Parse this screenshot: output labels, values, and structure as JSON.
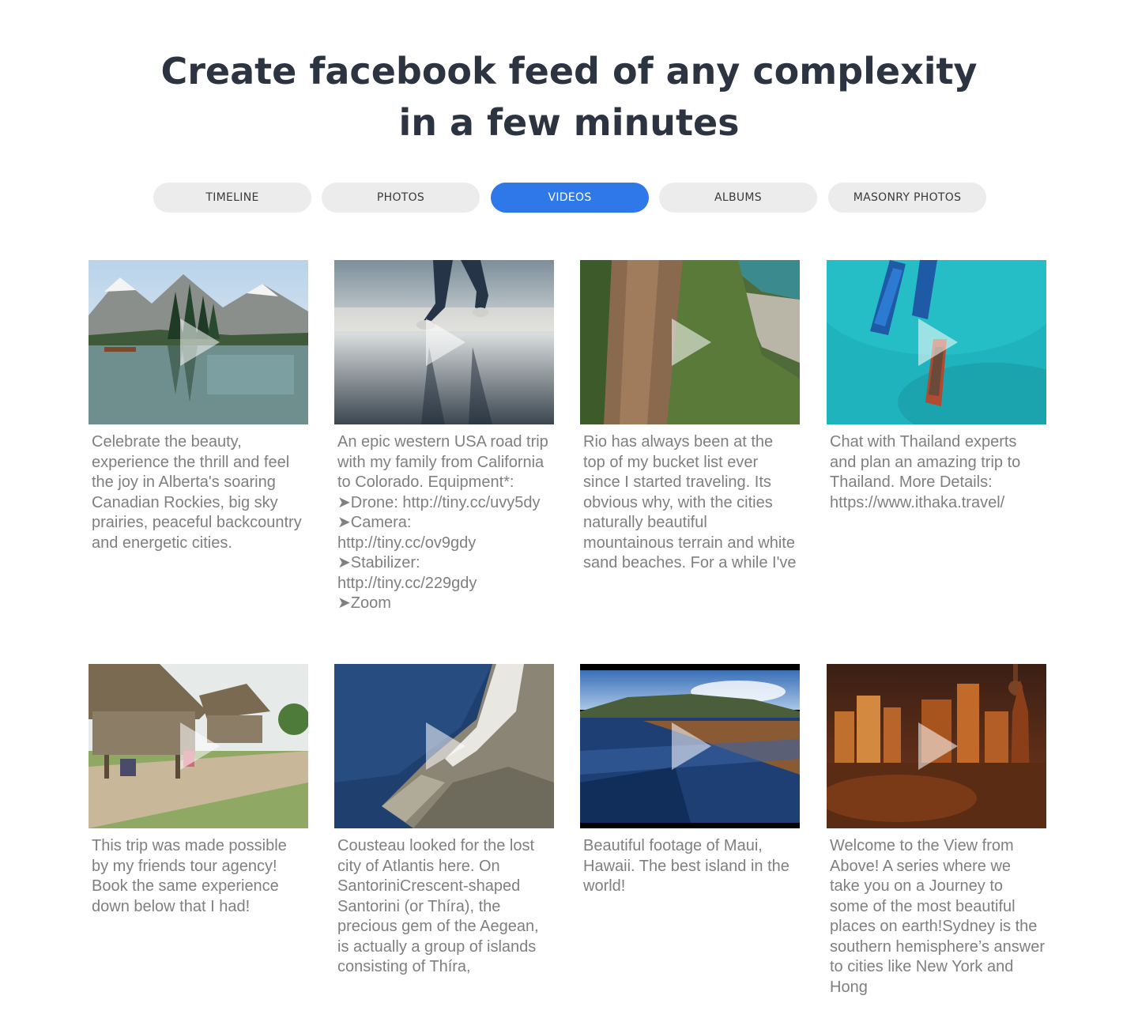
{
  "header": {
    "title_line1": "Create facebook feed of any complexity",
    "title_line2": "in a few minutes"
  },
  "tabs": [
    {
      "label": "TIMELINE",
      "active": false
    },
    {
      "label": "PHOTOS",
      "active": false
    },
    {
      "label": "VIDEOS",
      "active": true
    },
    {
      "label": "ALBUMS",
      "active": false
    },
    {
      "label": "MASONRY PHOTOS",
      "active": false
    }
  ],
  "colors": {
    "accent": "#2e78ea",
    "tab_bg": "#ececec",
    "title": "#2c3441",
    "caption": "#7f7f7f"
  },
  "videos": [
    {
      "thumb_scene": "mountain-lake-canoe",
      "caption": "Celebrate the beauty, experience the thrill and feel the joy in Alberta's soaring Canadian Rockies, big sky prairies, peaceful backcountry and energetic cities."
    },
    {
      "thumb_scene": "beach-walker",
      "caption": "An epic western USA road trip with my family from California to Colorado. Equipment*: ➤Drone: http://tiny.cc/uvy5dy\n➤Camera: http://tiny.cc/ov9gdy\n➤Stabilizer: http://tiny.cc/229gdy\n➤Zoom"
    },
    {
      "thumb_scene": "rio-aerial-mountain",
      "caption": "Rio has always been at the top of my bucket list ever since I started traveling. Its obvious why, with the cities naturally beautiful mountainous terrain and white sand beaches. For a while I've"
    },
    {
      "thumb_scene": "thailand-boats-aerial",
      "caption": "Chat with Thailand experts and plan an amazing trip to Thailand. More Details: https://www.ithaka.travel/"
    },
    {
      "thumb_scene": "thatched-huts-village",
      "caption": "This trip was made possible by my friends tour agency! Book the same experience down below that I had!"
    },
    {
      "thumb_scene": "santorini-aerial",
      "caption": "Cousteau looked for the lost city of Atlantis here. On SantoriniCrescent-shaped Santorini (or Thíra), the precious gem of the Aegean, is actually a group of islands consisting of Thíra,"
    },
    {
      "thumb_scene": "maui-shore-sunset",
      "caption": "Beautiful footage of Maui, Hawaii. The best island in the world!"
    },
    {
      "thumb_scene": "sydney-skyline-sunset",
      "caption": "Welcome to the View from Above! A series where we take you on a Journey to some of the most beautiful places on earth!Sydney is the southern hemisphere’s answer to cities like New York and Hong"
    }
  ]
}
